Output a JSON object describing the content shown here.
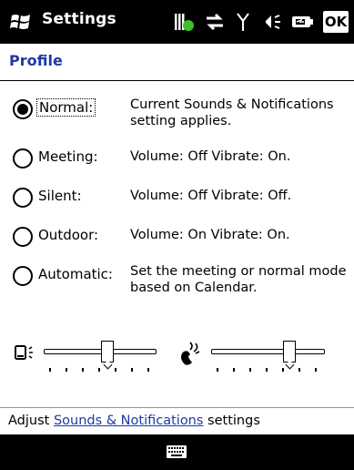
{
  "app": {
    "title": "Settings",
    "ok_label": "OK"
  },
  "header": {
    "title": "Profile"
  },
  "profiles": [
    {
      "label": "Normal:",
      "description": "Current Sounds & Notifications setting applies.",
      "selected": true
    },
    {
      "label": "Meeting:",
      "description": "Volume: Off  Vibrate: On.",
      "selected": false
    },
    {
      "label": "Silent:",
      "description": "Volume: Off  Vibrate: Off.",
      "selected": false
    },
    {
      "label": "Outdoor:",
      "description": "Volume: On  Vibrate: On.",
      "selected": false
    },
    {
      "label": "Automatic:",
      "description": "Set the meeting or normal mode based on Calendar.",
      "selected": false
    }
  ],
  "sliders": {
    "system_volume_level": 0.57,
    "ring_volume_level": 0.71
  },
  "footer": {
    "prefix": "Adjust ",
    "link": "Sounds & Notifications",
    "suffix": " settings"
  }
}
